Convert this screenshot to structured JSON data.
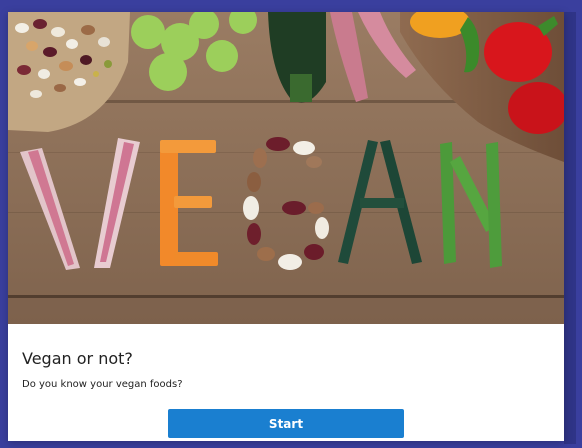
{
  "card": {
    "title": "Vegan or not?",
    "subtitle": "Do you know your vegan foods?",
    "start_label": "Start"
  },
  "hero": {
    "word": "VEGAN"
  },
  "colors": {
    "frame": "#3a3f9e",
    "button": "#1a7fd0",
    "wood": "#8b6d54"
  }
}
